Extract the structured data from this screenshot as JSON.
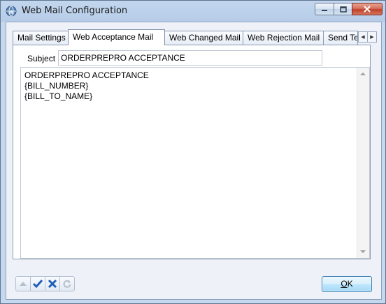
{
  "window": {
    "title": "Web Mail Configuration"
  },
  "tabs": [
    {
      "label": "Mail Settings"
    },
    {
      "label": "Web Acceptance Mail"
    },
    {
      "label": "Web Changed Mail"
    },
    {
      "label": "Web Rejection Mail"
    },
    {
      "label": "Send Te"
    }
  ],
  "active_tab": "Web Acceptance Mail",
  "form": {
    "subject_label": "Subject",
    "subject_value": "ORDERPREPRO ACCEPTANCE",
    "body_lines": [
      "ORDERPREPRO ACCEPTANCE",
      "{BILL_NUMBER}",
      "{BILL_TO_NAME}"
    ]
  },
  "footer": {
    "ok_label": "OK",
    "ok_mnemonic": "O",
    "ok_rest": "K"
  },
  "colors": {
    "accent": "#3c7fb1",
    "close_button": "#c1412b"
  }
}
